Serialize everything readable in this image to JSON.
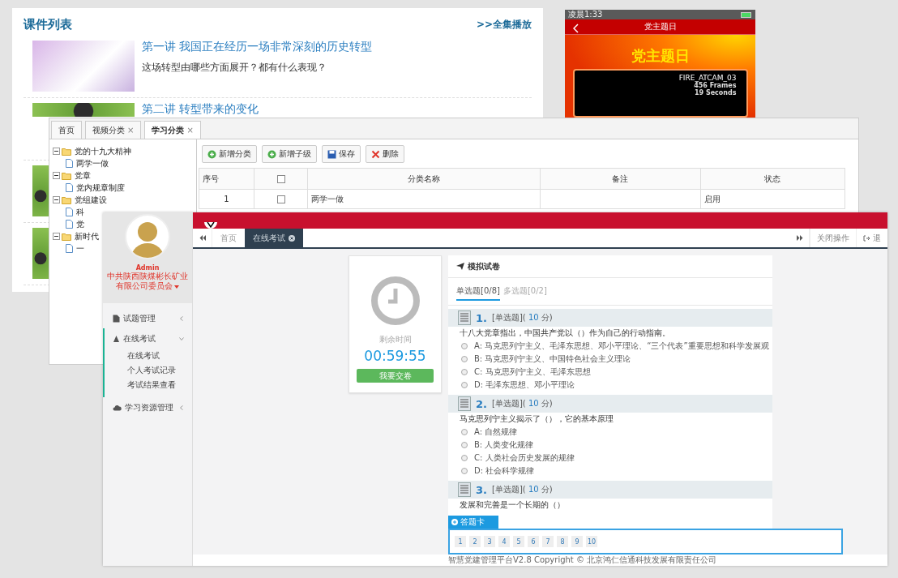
{
  "course_list": {
    "title": "课件列表",
    "play_all": ">>全集播放",
    "items": [
      {
        "kind": "slide",
        "title": "第一讲 我国正在经历一场非常深刻的历史转型",
        "description": "这场转型由哪些方面展开？都有什么表现？"
      },
      {
        "kind": "photo",
        "title": "第二讲 转型带来的变化"
      }
    ]
  },
  "mobile": {
    "status_time": "凌晨1:33",
    "title": "党主题日",
    "banner": "党主题日",
    "video": {
      "name": "FIRE_ATCAM_03",
      "frames": "456 Frames",
      "duration": "19 Seconds"
    }
  },
  "category_window": {
    "tabs": [
      {
        "label": "首页",
        "selected": false
      },
      {
        "label": "视频分类",
        "close": "×",
        "selected": false
      },
      {
        "label": "学习分类",
        "close": "×",
        "selected": true
      }
    ],
    "tree": [
      {
        "label": "党的十九大精神",
        "expanded": true,
        "children": [
          {
            "label": "两学一做"
          }
        ]
      },
      {
        "label": "党章",
        "expanded": true,
        "children": [
          {
            "label": "党内规章制度"
          }
        ]
      },
      {
        "label": "党组建设",
        "expanded": true,
        "children": [
          {
            "label": "科"
          },
          {
            "label": "党"
          }
        ]
      },
      {
        "label": "新时代",
        "expanded": true,
        "children": [
          {
            "label": "一"
          }
        ]
      }
    ],
    "toolbar": [
      {
        "kind": "add",
        "label": "新增分类"
      },
      {
        "kind": "add",
        "label": "新增子级"
      },
      {
        "kind": "save",
        "label": "保存"
      },
      {
        "kind": "delete",
        "label": "删除"
      }
    ],
    "table": {
      "columns": [
        {
          "kind": "text",
          "label": "序号"
        },
        {
          "kind": "checkbox",
          "checked": false
        },
        {
          "kind": "text",
          "label": "分类名称"
        },
        {
          "kind": "text",
          "label": "备注"
        },
        {
          "kind": "text",
          "label": "状态"
        }
      ],
      "rows": [
        {
          "index": "1",
          "checked": false,
          "name": "两学一做",
          "status": "启用"
        }
      ]
    }
  },
  "exam_window": {
    "user": {
      "name": "Admin",
      "org": "中共陕西陕煤彬长矿业有限公司委员会"
    },
    "menu": [
      {
        "kind": "file",
        "label": "试题管理",
        "expanded": false
      },
      {
        "kind": "exam",
        "label": "在线考试",
        "expanded": true,
        "children": [
          "在线考试",
          "个人考试记录",
          "考试结果查看"
        ]
      },
      {
        "kind": "cloud",
        "label": "学习资源管理",
        "expanded": false
      }
    ],
    "tabs": [
      {
        "label": "首页",
        "selected": false
      },
      {
        "label": "在线考试",
        "selected": true,
        "closable": true
      }
    ],
    "right_actions": [
      {
        "kind": "forward"
      },
      {
        "kind": "text",
        "label": "关闭操作"
      },
      {
        "kind": "exit",
        "label": "退"
      }
    ],
    "timer": {
      "label": "剩余时间",
      "value": "00:59:55",
      "submit": "我要交卷"
    },
    "paper": {
      "title": "模拟试卷",
      "tabs": [
        {
          "label": "单选题[0/8]",
          "selected": true
        },
        {
          "label": "多选题[0/2]",
          "selected": false
        }
      ],
      "questions": [
        {
          "number": "1.",
          "type": "[单选题](",
          "score": "10",
          "unit": "分)",
          "text": "十八大党章指出，中国共产党以（）作为自己的行动指南。",
          "options": [
            {
              "label": "A: 马克思列宁主义、毛泽东思想、邓小平理论、“三个代表”重要思想和科学发展观",
              "selected": false
            },
            {
              "label": "B: 马克思列宁主义、中国特色社会主义理论",
              "selected": false
            },
            {
              "label": "C: 马克思列宁主义、毛泽东思想",
              "selected": false
            },
            {
              "label": "D: 毛泽东思想、邓小平理论",
              "selected": false
            }
          ]
        },
        {
          "number": "2.",
          "type": "[单选题](",
          "score": "10",
          "unit": "分)",
          "text": "马克思列宁主义揭示了（），它的基本原理",
          "options": [
            {
              "label": "A: 自然规律",
              "selected": false
            },
            {
              "label": "B: 人类变化规律",
              "selected": false
            },
            {
              "label": "C: 人类社会历史发展的规律",
              "selected": false
            },
            {
              "label": "D: 社会科学规律",
              "selected": false
            }
          ]
        },
        {
          "number": "3.",
          "type": "[单选题](",
          "score": "10",
          "unit": "分)",
          "text": "发展和完善是一个长期的（）"
        }
      ]
    },
    "answer_card": {
      "title": "答题卡",
      "numbers": [
        "1",
        "2",
        "3",
        "4",
        "5",
        "6",
        "7",
        "8",
        "9",
        "10"
      ]
    },
    "footer": "智慧党建管理平台V2.8 Copyright © 北京鸿仁信通科技发展有限责任公司"
  }
}
